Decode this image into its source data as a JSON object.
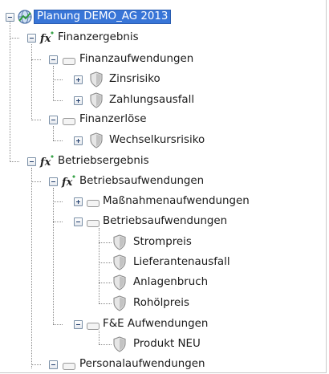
{
  "tree": {
    "root": {
      "label": "Planung DEMO_AG 2013",
      "icon": "globe-chart-icon",
      "selected": true
    },
    "finanzergebnis": {
      "label": "Finanzergebnis",
      "icon": "function-icon"
    },
    "finanzaufwendungen": {
      "label": "Finanzaufwendungen",
      "icon": "folder-icon"
    },
    "zinsrisiko": {
      "label": "Zinsrisiko",
      "icon": "shield-icon"
    },
    "zahlungsausfall": {
      "label": "Zahlungsausfall",
      "icon": "shield-icon"
    },
    "finanzerloese": {
      "label": "Finanzerlöse",
      "icon": "folder-icon"
    },
    "wechselkursrisiko": {
      "label": "Wechselkursrisiko",
      "icon": "shield-icon"
    },
    "betriebsergebnis": {
      "label": "Betriebsergebnis",
      "icon": "function-icon"
    },
    "betriebsaufwendungen_fx": {
      "label": "Betriebsaufwendungen",
      "icon": "function-icon"
    },
    "massnahmenaufwendungen": {
      "label": "Maßnahmenaufwendungen",
      "icon": "folder-icon"
    },
    "betriebsaufwendungen": {
      "label": "Betriebsaufwendungen",
      "icon": "folder-icon"
    },
    "strompreis": {
      "label": "Strompreis",
      "icon": "shield-icon"
    },
    "lieferantenausfall": {
      "label": "Lieferantenausfall",
      "icon": "shield-icon"
    },
    "anlagenbruch": {
      "label": "Anlagenbruch",
      "icon": "shield-icon"
    },
    "rohoelpreis": {
      "label": "Rohölpreis",
      "icon": "shield-icon"
    },
    "fe_aufwendungen": {
      "label": "F&E Aufwendungen",
      "icon": "folder-icon"
    },
    "produkt_neu": {
      "label": "Produkt NEU",
      "icon": "shield-icon"
    },
    "personalaufwendungen": {
      "label": "Personalaufwendungen",
      "icon": "folder-icon"
    }
  }
}
